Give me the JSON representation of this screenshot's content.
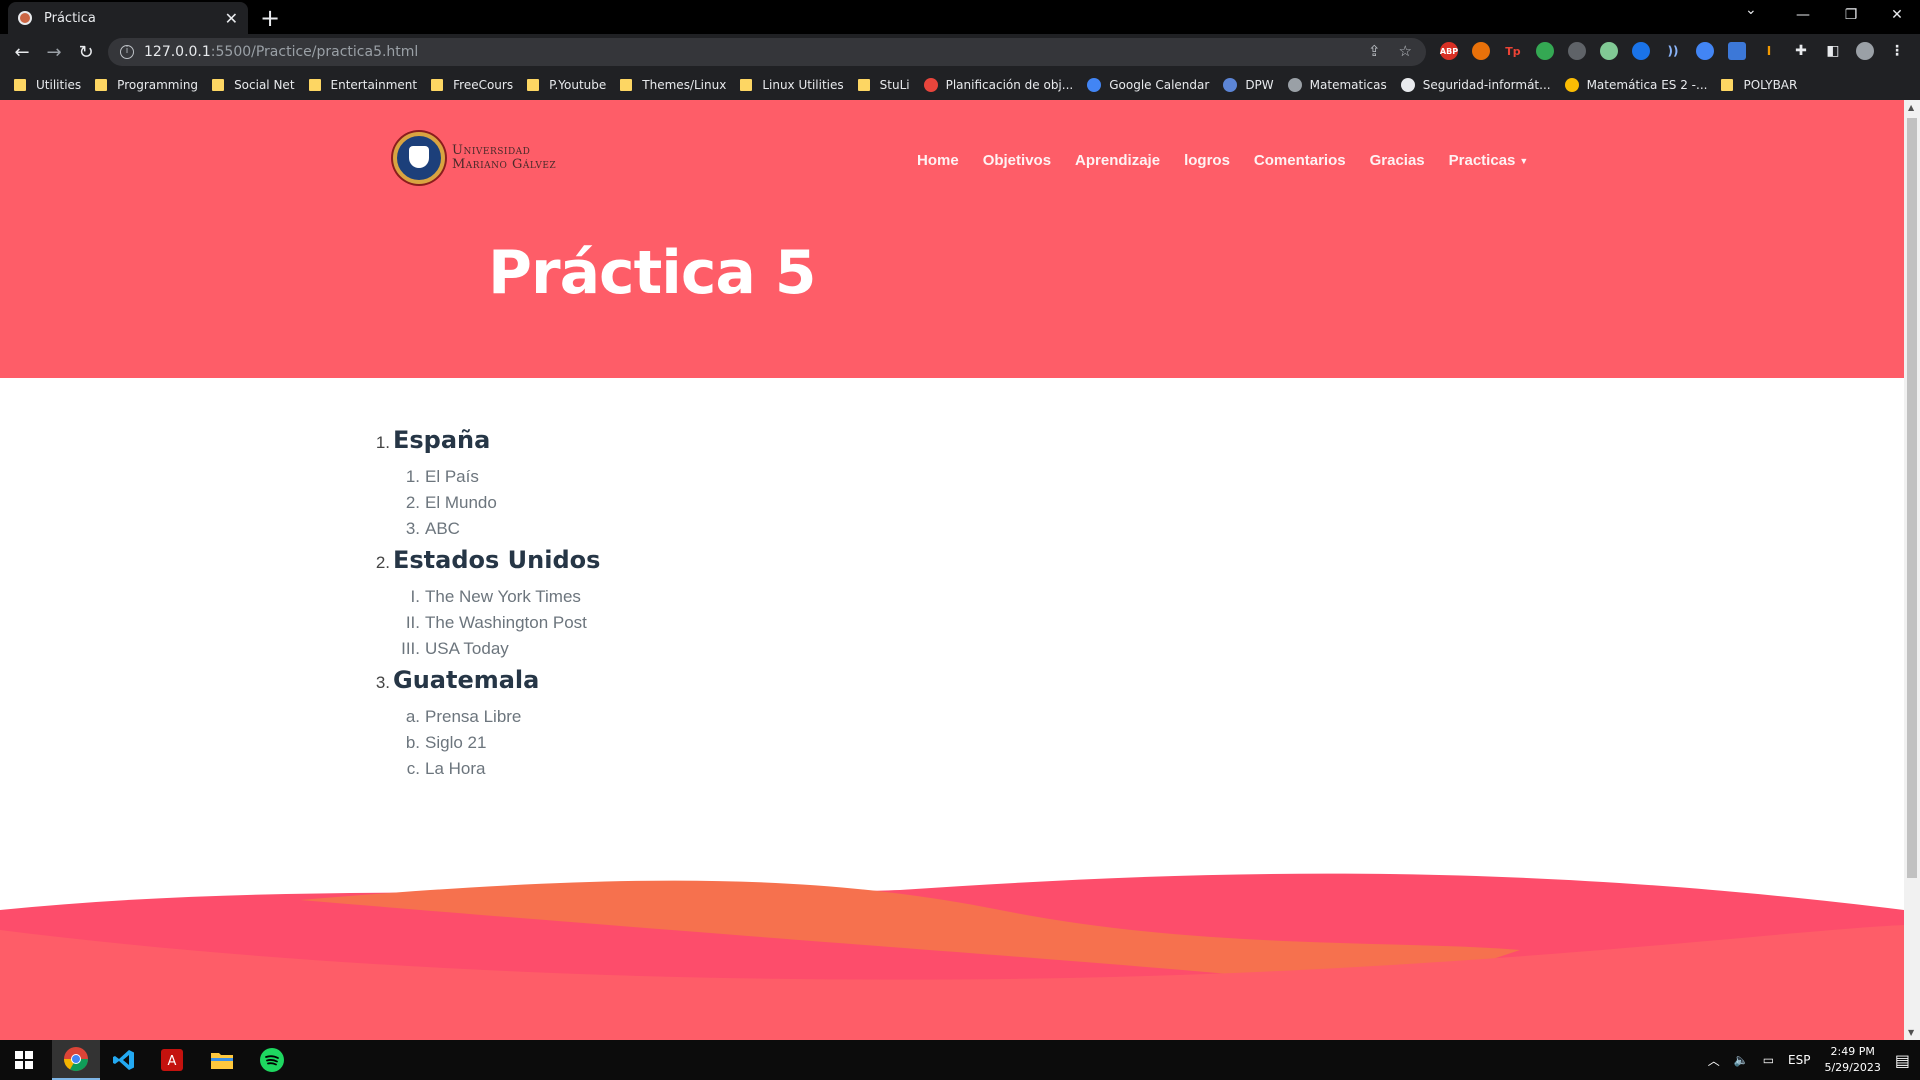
{
  "browser": {
    "tab_title": "Práctica",
    "url_host": "127.0.0.1",
    "url_path": ":5500/Practice/practica5.html",
    "bookmarks": [
      {
        "label": "Utilities",
        "kind": "folder"
      },
      {
        "label": "Programming",
        "kind": "folder"
      },
      {
        "label": "Social Net",
        "kind": "folder"
      },
      {
        "label": "Entertainment",
        "kind": "folder"
      },
      {
        "label": "FreeCours",
        "kind": "folder"
      },
      {
        "label": "P.Youtube",
        "kind": "folder"
      },
      {
        "label": "Themes/Linux",
        "kind": "folder"
      },
      {
        "label": "Linux Utilities",
        "kind": "folder"
      },
      {
        "label": "StuLi",
        "kind": "folder"
      },
      {
        "label": "Planificación de obj...",
        "kind": "site"
      },
      {
        "label": "Google Calendar",
        "kind": "site"
      },
      {
        "label": "DPW",
        "kind": "site"
      },
      {
        "label": "Matematicas",
        "kind": "site"
      },
      {
        "label": "Seguridad-informát...",
        "kind": "site"
      },
      {
        "label": "Matemática ES 2 -...",
        "kind": "site"
      },
      {
        "label": "POLYBAR",
        "kind": "folder"
      }
    ],
    "extensions": [
      "ABP",
      "Tp"
    ]
  },
  "site": {
    "logo_line1": "Universidad",
    "logo_line2": "Mariano Gálvez",
    "nav": [
      "Home",
      "Objetivos",
      "Aprendizaje",
      "logros",
      "Comentarios",
      "Gracias",
      "Practicas"
    ],
    "title": "Práctica 5",
    "colors": {
      "hero": "#fe5d68",
      "wave_orange": "#f6714e",
      "wave_pink": "#fd4d6b"
    }
  },
  "countries": [
    {
      "num": "1.",
      "name": "España",
      "papers": [
        {
          "num": "1.",
          "name": "El País"
        },
        {
          "num": "2.",
          "name": "El Mundo"
        },
        {
          "num": "3.",
          "name": "ABC"
        }
      ]
    },
    {
      "num": "2.",
      "name": "Estados Unidos",
      "papers": [
        {
          "num": "I.",
          "name": "The New York Times"
        },
        {
          "num": "II.",
          "name": "The Washington Post"
        },
        {
          "num": "III.",
          "name": "USA Today"
        }
      ]
    },
    {
      "num": "3.",
      "name": "Guatemala",
      "papers": [
        {
          "num": "a.",
          "name": "Prensa Libre"
        },
        {
          "num": "b.",
          "name": "Siglo 21"
        },
        {
          "num": "c.",
          "name": "La Hora"
        }
      ]
    }
  ],
  "taskbar": {
    "language": "ESP",
    "time": "2:49 PM",
    "date": "5/29/2023"
  }
}
